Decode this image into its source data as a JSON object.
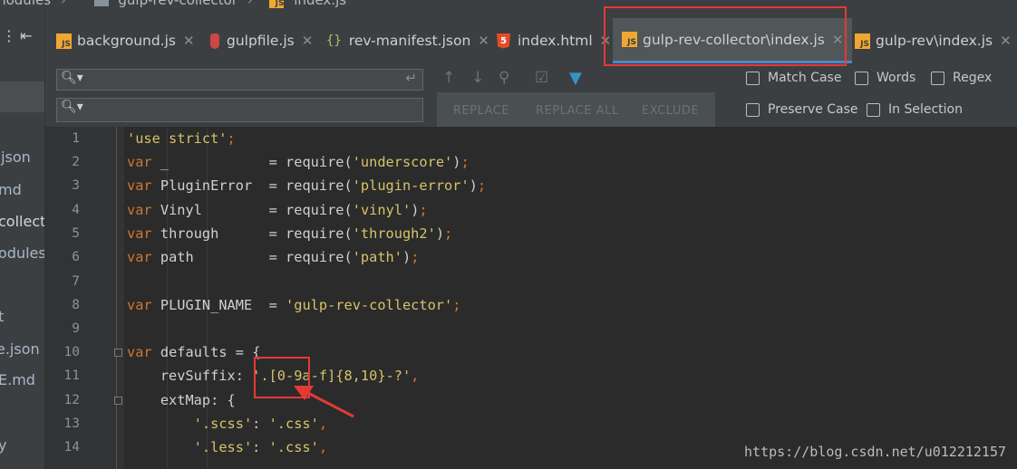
{
  "breadcrumb": {
    "items": [
      "modules",
      "gulp-rev-collector",
      "index.js"
    ]
  },
  "left_panel": {
    "items": [
      ".json",
      "md",
      "collecto",
      "odules",
      "t",
      "e.json",
      "E.md",
      "y"
    ]
  },
  "tabs": [
    {
      "label": "background.js",
      "icon": "js-file-icon"
    },
    {
      "label": "gulpfile.js",
      "icon": "gulp-file-icon"
    },
    {
      "label": "rev-manifest.json",
      "icon": "json-file-icon"
    },
    {
      "label": "index.html",
      "icon": "html5-file-icon"
    },
    {
      "label": "gulp-rev-collector\\index.js",
      "icon": "js-file-icon",
      "active": true
    },
    {
      "label": "gulp-rev\\index.js",
      "icon": "js-file-icon"
    }
  ],
  "find": {
    "find_value": "",
    "replace_value": "",
    "replace_label": "REPLACE",
    "replace_all_label": "REPLACE ALL",
    "exclude_label": "EXCLUDE",
    "options": {
      "match_case": "Match Case",
      "words": "Words",
      "regex": "Regex",
      "preserve_case": "Preserve Case",
      "in_selection": "In Selection"
    }
  },
  "editor": {
    "line_numbers": [
      "1",
      "2",
      "3",
      "4",
      "5",
      "6",
      "7",
      "8",
      "9",
      "10",
      "11",
      "12",
      "13",
      "14"
    ],
    "lines": [
      "'use strict';",
      "var _            = require('underscore');",
      "var PluginError  = require('plugin-error');",
      "var Vinyl        = require('vinyl');",
      "var through      = require('through2');",
      "var path         = require('path');",
      "",
      "var PLUGIN_NAME  = 'gulp-rev-collector';",
      "",
      "var defaults = {",
      "    revSuffix: '.[0-9a-f]{8,10}-?',",
      "    extMap: {",
      "        '.scss': '.css',",
      "        '.less': '.css',"
    ]
  },
  "watermark": "https://blog.csdn.net/u012212157",
  "colors": {
    "annotation_red": "#e53935",
    "keyword": "#cc7832",
    "string": "#d6c36a"
  }
}
